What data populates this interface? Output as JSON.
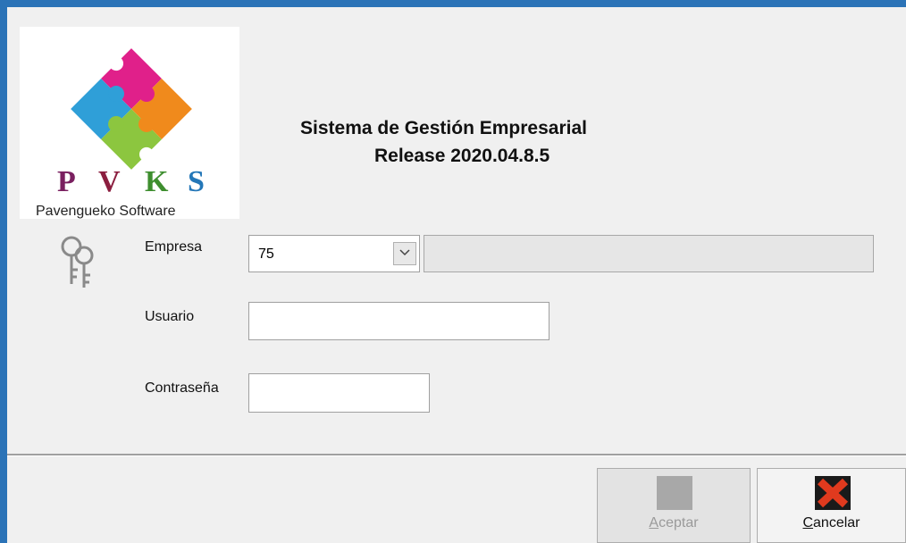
{
  "logo": {
    "letters": [
      "P",
      "V",
      "K",
      "S"
    ],
    "letter_colors": [
      "#7a2060",
      "#8b1e3f",
      "#3e8e2f",
      "#2477b8"
    ],
    "subtitle": "Pavengueko Software",
    "icon": "puzzle-logo"
  },
  "header": {
    "line1": "Sistema de Gestión Empresarial",
    "line2": "Release 2020.04.8.5"
  },
  "form": {
    "empresa_label": "Empresa",
    "empresa_value": "75",
    "empresa_name": "",
    "usuario_label": "Usuario",
    "usuario_value": "",
    "password_label": "Contraseña",
    "password_value": "",
    "keys_icon": "keys-icon"
  },
  "buttons": {
    "aceptar_first": "A",
    "aceptar_rest": "ceptar",
    "aceptar_enabled": false,
    "cancelar_first": "C",
    "cancelar_rest": "ancelar",
    "cancel_icon": "red-x-icon"
  }
}
